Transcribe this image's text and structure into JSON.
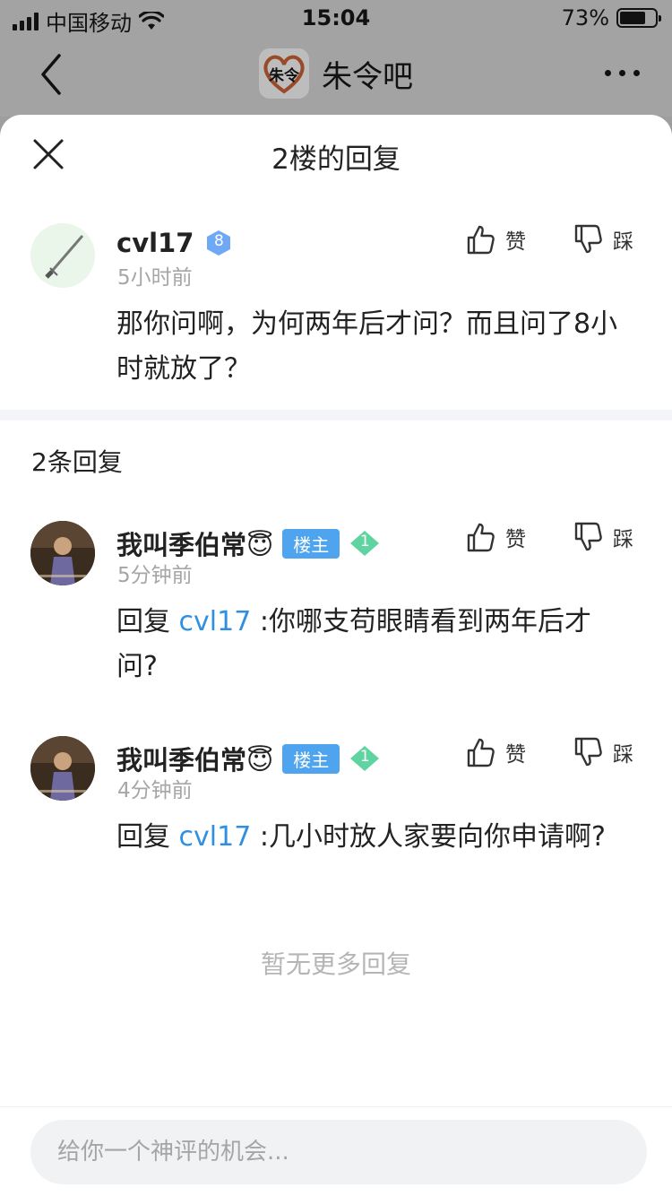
{
  "status_bar": {
    "carrier": "中国移动",
    "time": "15:04",
    "battery": "73%",
    "battery_level": 0.73
  },
  "nav": {
    "forum_name": "朱令吧",
    "logo_text": "朱令"
  },
  "sheet": {
    "title": "2楼的回复"
  },
  "main_post": {
    "username": "cvl17",
    "level": "8",
    "time": "5小时前",
    "content": "那你问啊，为何两年后才问？而且问了8小时就放了？",
    "like_label": "赞",
    "dislike_label": "踩"
  },
  "reply_count": "2条回复",
  "replies": [
    {
      "username": "我叫季伯常😇",
      "badge": "楼主",
      "level": "1",
      "time": "5分钟前",
      "prefix": "回复 ",
      "mention": "cvl17",
      "content": " :你哪支苟眼睛看到两年后才问?",
      "like_label": "赞",
      "dislike_label": "踩"
    },
    {
      "username": "我叫季伯常😇",
      "badge": "楼主",
      "level": "1",
      "time": "4分钟前",
      "prefix": "回复 ",
      "mention": "cvl17",
      "content": " :几小时放人家要向你申请啊?",
      "like_label": "赞",
      "dislike_label": "踩"
    }
  ],
  "no_more": "暂无更多回复",
  "composer": {
    "placeholder": "给你一个神评的机会..."
  },
  "colors": {
    "mention": "#2f8fe0",
    "badge": "#4ea4ee",
    "level_badge": "#6fa8f5",
    "gem": "#5fd3a0"
  }
}
